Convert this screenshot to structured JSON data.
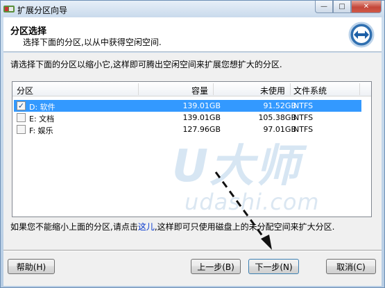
{
  "window": {
    "title": "扩展分区向导",
    "minimize_glyph": "—",
    "maximize_glyph": "□",
    "close_glyph": "✕"
  },
  "header": {
    "title": "分区选择",
    "subtitle": "选择下面的分区,以从中获得空闲空间."
  },
  "instruction": "请选择下面的分区以缩小它,这样即可腾出空闲空间来扩展您想扩大的分区.",
  "table": {
    "columns": [
      "分区",
      "容量",
      "未使用",
      "文件系统"
    ],
    "rows": [
      {
        "checked": true,
        "name": "D: 软件",
        "capacity": "139.01GB",
        "unused": "91.52GB",
        "fs": "NTFS",
        "selected": true
      },
      {
        "checked": false,
        "name": "E: 文档",
        "capacity": "139.01GB",
        "unused": "105.38GB",
        "fs": "NTFS",
        "selected": false
      },
      {
        "checked": false,
        "name": "F: 娱乐",
        "capacity": "127.96GB",
        "unused": "97.01GB",
        "fs": "NTFS",
        "selected": false
      }
    ]
  },
  "footnote": {
    "before": "如果您不能缩小上面的分区,请点击",
    "link": "这儿",
    "after": ",这样即可只使用磁盘上的未分配空间来扩大分区."
  },
  "watermark": {
    "logo_text": "U大师",
    "url_text": "udashi.com"
  },
  "buttons": {
    "help": "帮助(H)",
    "back": "上一步(B)",
    "next": "下一步(N)",
    "cancel": "取消(C)"
  },
  "colors": {
    "selection": "#3399ff",
    "link": "#0033cc",
    "watermark": "#d7e6f3"
  },
  "icons": {
    "app": "partition-app-icon",
    "wizard": "double-arrow-icon",
    "annotation": "dashed-arrow-icon"
  }
}
